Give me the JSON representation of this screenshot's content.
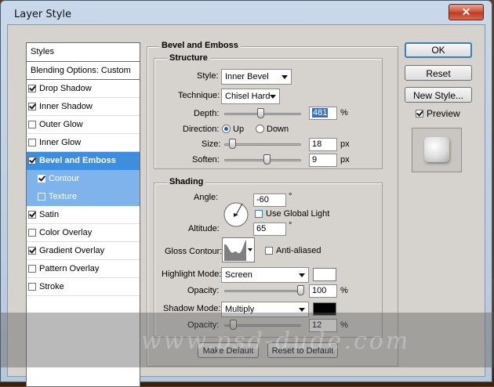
{
  "window": {
    "title": "Layer Style",
    "close_symbol": "✕"
  },
  "styles_panel": {
    "header": "Styles",
    "blending_options": "Blending Options: Custom",
    "items": [
      {
        "label": "Drop Shadow",
        "checked": true
      },
      {
        "label": "Inner Shadow",
        "checked": true
      },
      {
        "label": "Outer Glow",
        "checked": false
      },
      {
        "label": "Inner Glow",
        "checked": false
      },
      {
        "label": "Bevel and Emboss",
        "checked": true
      },
      {
        "label": "Contour",
        "checked": true
      },
      {
        "label": "Texture",
        "checked": false
      },
      {
        "label": "Satin",
        "checked": true
      },
      {
        "label": "Color Overlay",
        "checked": false
      },
      {
        "label": "Gradient Overlay",
        "checked": true
      },
      {
        "label": "Pattern Overlay",
        "checked": false
      },
      {
        "label": "Stroke",
        "checked": false
      }
    ]
  },
  "buttons": {
    "ok": "OK",
    "reset": "Reset",
    "new_style": "New Style...",
    "preview_label": "Preview",
    "preview_checked": true
  },
  "bevel": {
    "section_title": "Bevel and Emboss",
    "structure_title": "Structure",
    "style_label": "Style:",
    "style_value": "Inner Bevel",
    "technique_label": "Technique:",
    "technique_value": "Chisel Hard",
    "depth_label": "Depth:",
    "depth_value": "481",
    "depth_unit": "%",
    "direction_label": "Direction:",
    "up_label": "Up",
    "down_label": "Down",
    "size_label": "Size:",
    "size_value": "18",
    "size_unit": "px",
    "soften_label": "Soften:",
    "soften_value": "9",
    "soften_unit": "px"
  },
  "shading": {
    "title": "Shading",
    "angle_label": "Angle:",
    "angle_value": "-60",
    "degree_symbol": "°",
    "global_light_label": "Use Global Light",
    "global_light_checked": false,
    "altitude_label": "Altitude:",
    "altitude_value": "65",
    "gloss_label": "Gloss Contour:",
    "anti_aliased_label": "Anti-aliased",
    "anti_aliased_checked": false,
    "highlight_mode_label": "Highlight Mode:",
    "highlight_mode_value": "Screen",
    "highlight_color": "#ffffff",
    "highlight_opacity_label": "Opacity:",
    "highlight_opacity_value": "100",
    "shadow_mode_label": "Shadow Mode:",
    "shadow_mode_value": "Multiply",
    "shadow_color": "#000000",
    "shadow_opacity_label": "Opacity:",
    "shadow_opacity_value": "12",
    "percent": "%"
  },
  "footer": {
    "make_default": "Make Default",
    "reset_default": "Reset to Default"
  },
  "watermark": "www.psd-dude.com"
}
